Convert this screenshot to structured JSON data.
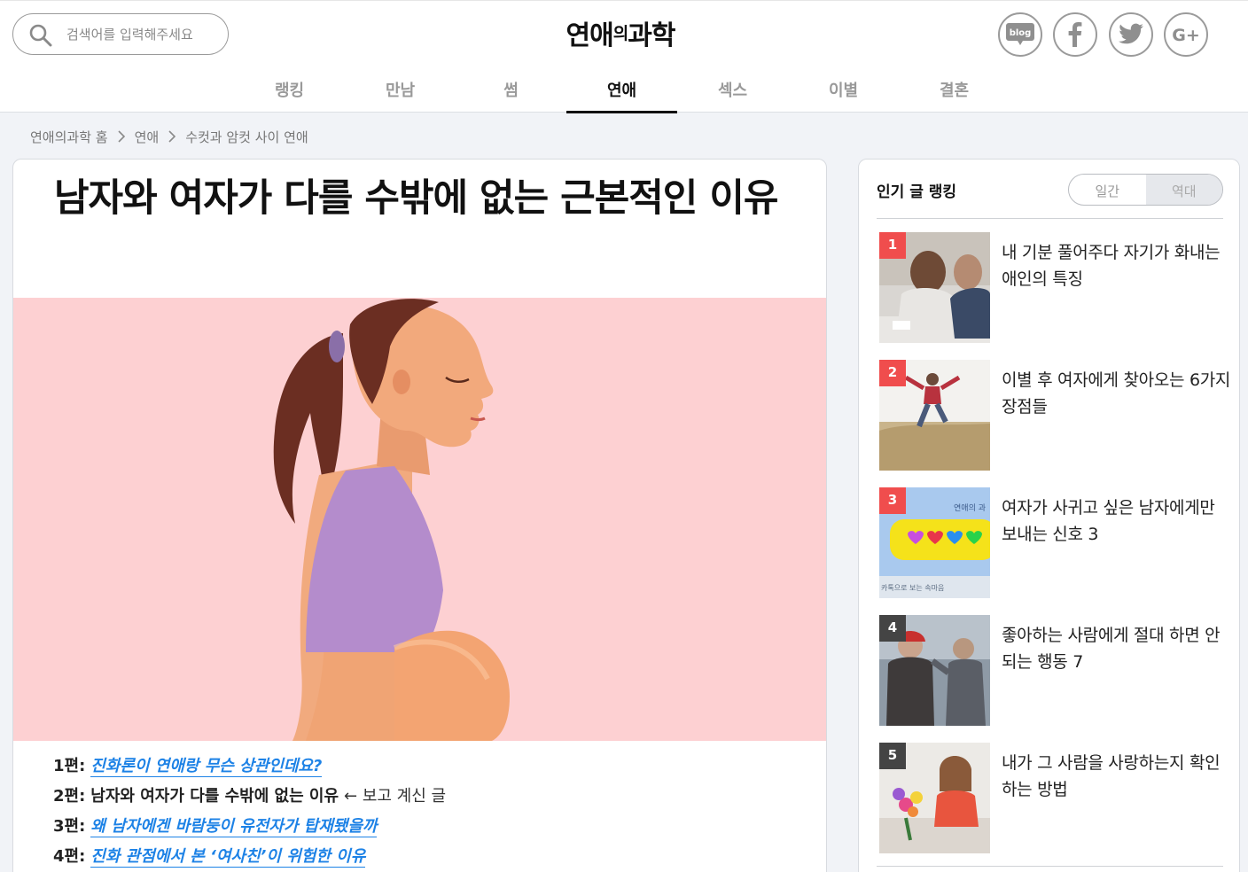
{
  "header": {
    "search": {
      "placeholder": "검색어를 입력해주세요"
    },
    "logo": {
      "main": "연애",
      "mid": "의",
      "tail": "과학"
    },
    "social": [
      {
        "icon": "blog-icon",
        "label": "blog"
      },
      {
        "icon": "facebook-icon",
        "label": "f"
      },
      {
        "icon": "twitter-icon",
        "label": ""
      },
      {
        "icon": "google-plus-icon",
        "label": "G+"
      }
    ],
    "nav": [
      "랭킹",
      "만남",
      "썸",
      "연애",
      "섹스",
      "이별",
      "결혼"
    ],
    "nav_active": "연애"
  },
  "breadcrumb": [
    "연애의과학 홈",
    "연애",
    "수컷과 암컷 사이 연애"
  ],
  "article": {
    "title": "남자와 여자가 다를 수밖에 없는 근본적인 이유",
    "series": [
      {
        "num": "1편:",
        "text": "진화론이 연애랑 무슨 상관인데요?",
        "link": true
      },
      {
        "num": "2편:",
        "text": "남자와 여자가 다를 수밖에 없는 이유",
        "note": "← 보고 계신 글",
        "link": false
      },
      {
        "num": "3편:",
        "text": "왜 남자에겐 바람둥이 유전자가 탑재됐을까",
        "link": true
      },
      {
        "num": "4편:",
        "text": "진화 관점에서 본 ‘여사친’이 위험한 이유",
        "link": true
      }
    ]
  },
  "sidebar": {
    "title": "인기 글 랭킹",
    "tabs": [
      "일간",
      "역대"
    ],
    "active_tab": "역대",
    "items": [
      {
        "rank": "1",
        "title": "내 기분 풀어주다 자기가 화내는 애인의 특징"
      },
      {
        "rank": "2",
        "title": "이별 후 여자에게 찾아오는 6가지 장점들"
      },
      {
        "rank": "3",
        "title": "여자가 사귀고 싶은 남자에게만 보내는 신호 3",
        "thumb_text": "연애의 과",
        "thumb_caption": "카톡으로 보는 속마음"
      },
      {
        "rank": "4",
        "title": "좋아하는 사람에게 절대 하면 안 되는 행동 7"
      },
      {
        "rank": "5",
        "title": "내가 그 사람을 사랑하는지 확인하는 방법"
      }
    ]
  },
  "colors": {
    "accent_red": "#f04d4d",
    "link_blue": "#1d82e6",
    "hero_pink": "#fdd0d2"
  }
}
